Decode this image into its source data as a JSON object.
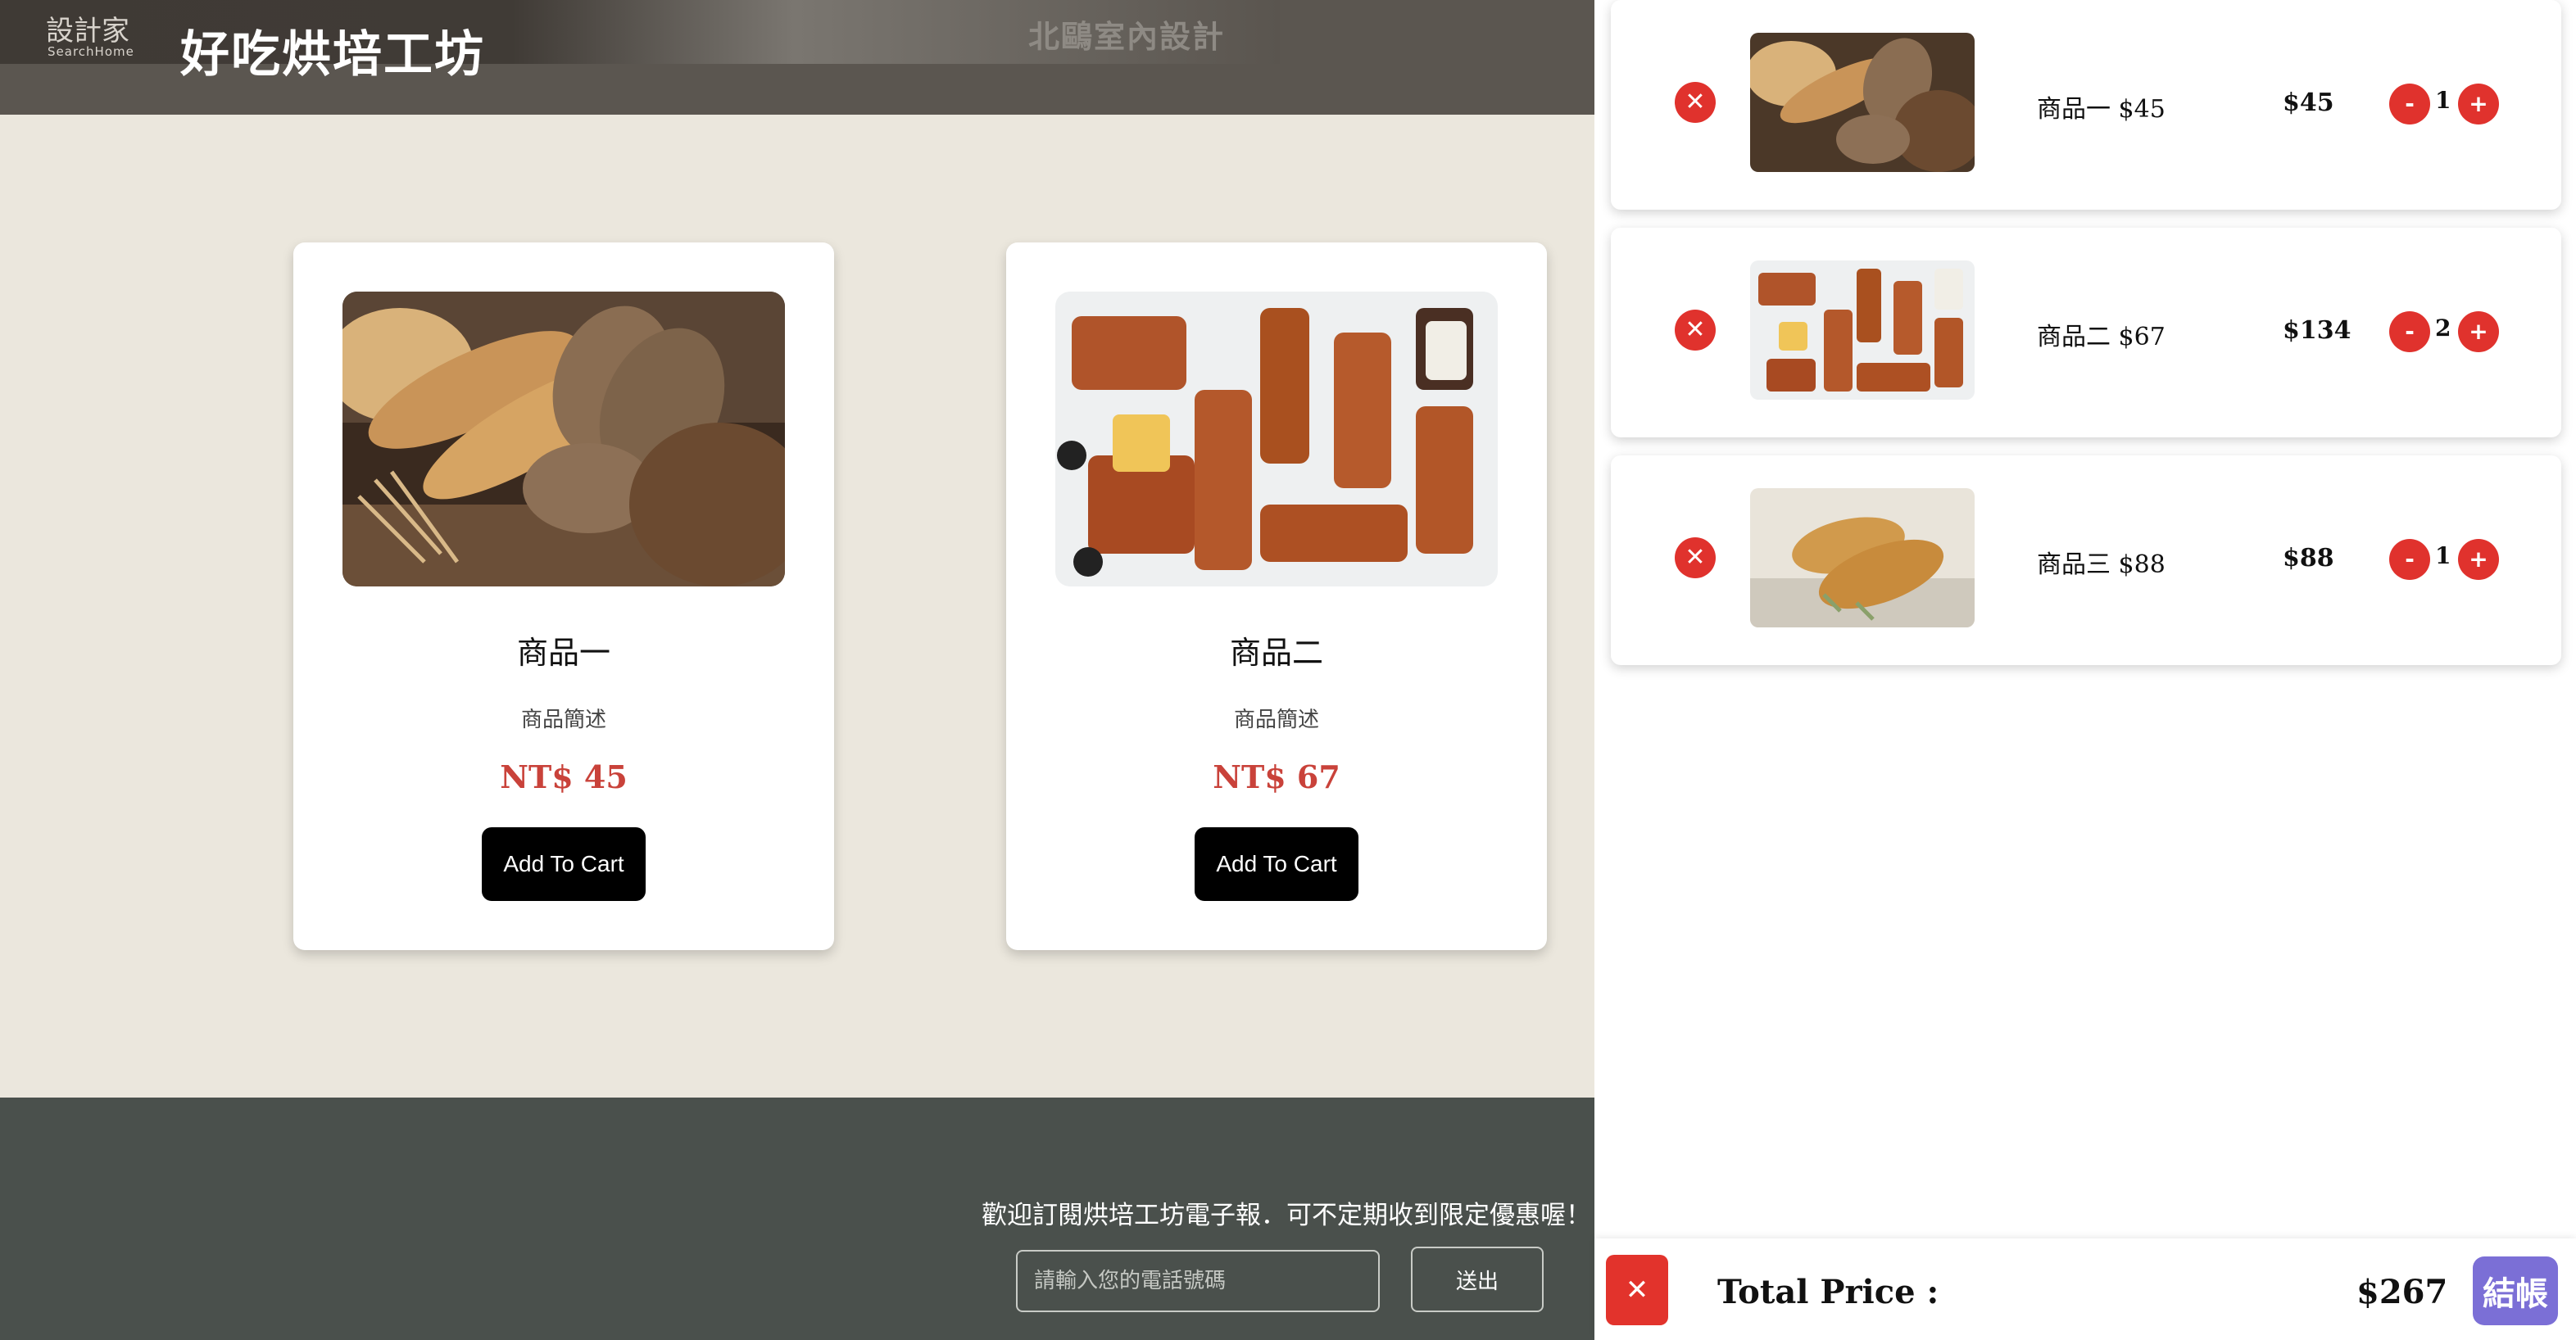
{
  "header": {
    "banner_logo_line1": "設計家",
    "banner_logo_line2": "SearchHome",
    "banner_right": "北鷗室內設計",
    "site_title": "好吃烘培工坊"
  },
  "products": [
    {
      "name": "商品一",
      "description": "商品簡述",
      "price": "NT$ 45",
      "button": "Add To Cart",
      "image": "bread-loaves-photo"
    },
    {
      "name": "商品二",
      "description": "商品簡述",
      "price": "NT$ 67",
      "button": "Add To Cart",
      "image": "pastry-rolls-photo"
    }
  ],
  "footer": {
    "message": "歡迎訂閱烘培工坊電子報．可不定期收到限定優惠喔！",
    "phone_placeholder": "請輸入您的電話號碼",
    "send_label": "送出"
  },
  "cart": {
    "items": [
      {
        "label": "商品一 $45",
        "subtotal": "$45",
        "qty": "1",
        "image": "bread-loaves-photo"
      },
      {
        "label": "商品二 $67",
        "subtotal": "$134",
        "qty": "2",
        "image": "pastry-rolls-photo"
      },
      {
        "label": "商品三 $88",
        "subtotal": "$88",
        "qty": "1",
        "image": "croissant-photo"
      }
    ],
    "minus_label": "-",
    "plus_label": "+",
    "remove_icon": "✕",
    "clear_icon": "✕",
    "total_label": "Total Price :",
    "total_value": "$267",
    "checkout_label": "結帳"
  },
  "colors": {
    "page_bg": "#ebe7dd",
    "header_bg": "#5b5650",
    "footer_bg": "#4a504c",
    "price_red": "#c9423a",
    "action_red": "#e0322d",
    "checkout_purple": "#7b6fd6"
  }
}
